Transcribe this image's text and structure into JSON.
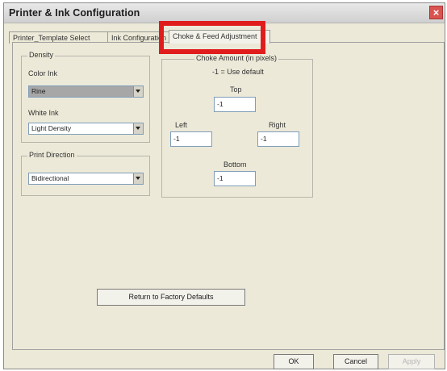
{
  "window": {
    "title": "Printer & Ink Configuration"
  },
  "tabs": [
    {
      "label": "Printer_Template Select"
    },
    {
      "label": "Ink Configuration"
    },
    {
      "label": "Choke & Feed Adjustment"
    }
  ],
  "density": {
    "legend": "Density",
    "color_ink_label": "Color Ink",
    "color_ink_value": "Rine",
    "white_ink_label": "White Ink",
    "white_ink_value": "Light Density"
  },
  "print_direction": {
    "legend": "Print Direction",
    "value": "Bidirectional"
  },
  "choke": {
    "legend": "Choke Amount (in pixels)",
    "hint": "-1 = Use default",
    "top_label": "Top",
    "top_value": "-1",
    "left_label": "Left",
    "left_value": "-1",
    "right_label": "Right",
    "right_value": "-1",
    "bottom_label": "Bottom",
    "bottom_value": "-1"
  },
  "buttons": {
    "return_defaults": "Return to Factory Defaults",
    "ok": "OK",
    "cancel": "Cancel",
    "apply": "Apply"
  },
  "colors": {
    "highlight": "#e11c1c",
    "window_bg": "#ece9d8"
  }
}
